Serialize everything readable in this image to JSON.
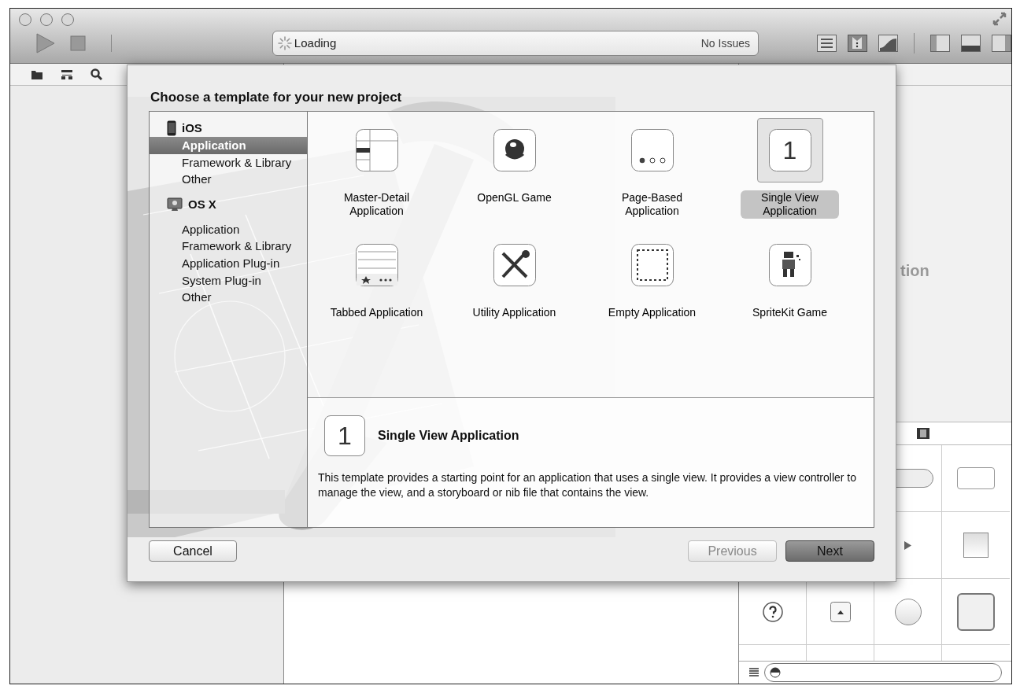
{
  "toolbar": {
    "status": "Loading",
    "issues": "No Issues"
  },
  "inspector": {
    "partial_text": "tion"
  },
  "dialog": {
    "title": "Choose a template for your new project",
    "sidebar": [
      {
        "label": "iOS",
        "kind": "ios",
        "items": [
          {
            "label": "Application",
            "selected": true
          },
          {
            "label": "Framework & Library",
            "selected": false
          },
          {
            "label": "Other",
            "selected": false
          }
        ]
      },
      {
        "label": "OS X",
        "kind": "osx",
        "items": [
          {
            "label": "Application",
            "selected": false
          },
          {
            "label": "Framework & Library",
            "selected": false
          },
          {
            "label": "Application Plug-in",
            "selected": false
          },
          {
            "label": "System Plug-in",
            "selected": false
          },
          {
            "label": "Other",
            "selected": false
          }
        ]
      }
    ],
    "templates": [
      {
        "label": "Master-Detail Application",
        "kind": "master",
        "selected": false
      },
      {
        "label": "OpenGL Game",
        "kind": "opengl",
        "selected": false
      },
      {
        "label": "Page-Based Application",
        "kind": "page",
        "selected": false
      },
      {
        "label": "Single View Application",
        "kind": "single",
        "icon_label": "1",
        "selected": true
      },
      {
        "label": "Tabbed Application",
        "kind": "tabbed",
        "selected": false
      },
      {
        "label": "Utility Application",
        "kind": "utility",
        "selected": false
      },
      {
        "label": "Empty Application",
        "kind": "empty",
        "selected": false
      },
      {
        "label": "SpriteKit Game",
        "kind": "sprite",
        "selected": false
      }
    ],
    "detail": {
      "icon_label": "1",
      "title": "Single View Application",
      "description": "This template provides a starting point for an application that uses a single view. It provides a view controller to manage the view, and a storyboard or nib file that contains the view."
    },
    "buttons": [
      {
        "label": "Cancel",
        "kind": "cancel",
        "disabled": false,
        "default": false
      },
      {
        "label": "Previous",
        "kind": "previous",
        "disabled": true,
        "default": false
      },
      {
        "label": "Next",
        "kind": "next",
        "disabled": false,
        "default": true
      }
    ]
  }
}
